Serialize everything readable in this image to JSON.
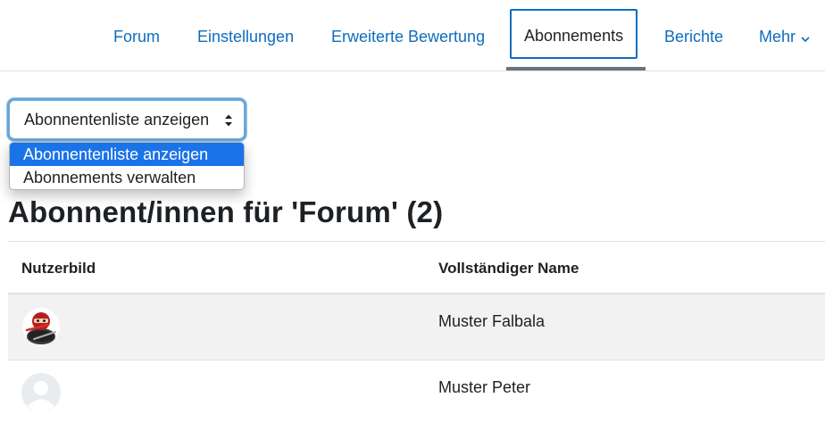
{
  "tabs": [
    {
      "label": "Forum"
    },
    {
      "label": "Einstellungen"
    },
    {
      "label": "Erweiterte Bewertung"
    },
    {
      "label": "Abonnements",
      "active": true
    },
    {
      "label": "Berichte"
    },
    {
      "label": "Mehr"
    }
  ],
  "view_select": {
    "value": "Abonnentenliste anzeigen",
    "options": [
      "Abonnentenliste anzeigen",
      "Abonnements verwalten"
    ]
  },
  "page_title": "Abonnent/innen für 'Forum' (2)",
  "table": {
    "headers": [
      "Nutzerbild",
      "Vollständiger Name"
    ],
    "rows": [
      {
        "name": "Muster Falbala",
        "avatar": "ninja-avatar-icon"
      },
      {
        "name": "Muster Peter",
        "avatar": "default-user-avatar-icon"
      }
    ]
  },
  "colors": {
    "link": "#0f6cbf",
    "selected_option": "#1a73e8",
    "focus_ring": "#6aa7d9",
    "stripe": "#f2f2f2"
  }
}
